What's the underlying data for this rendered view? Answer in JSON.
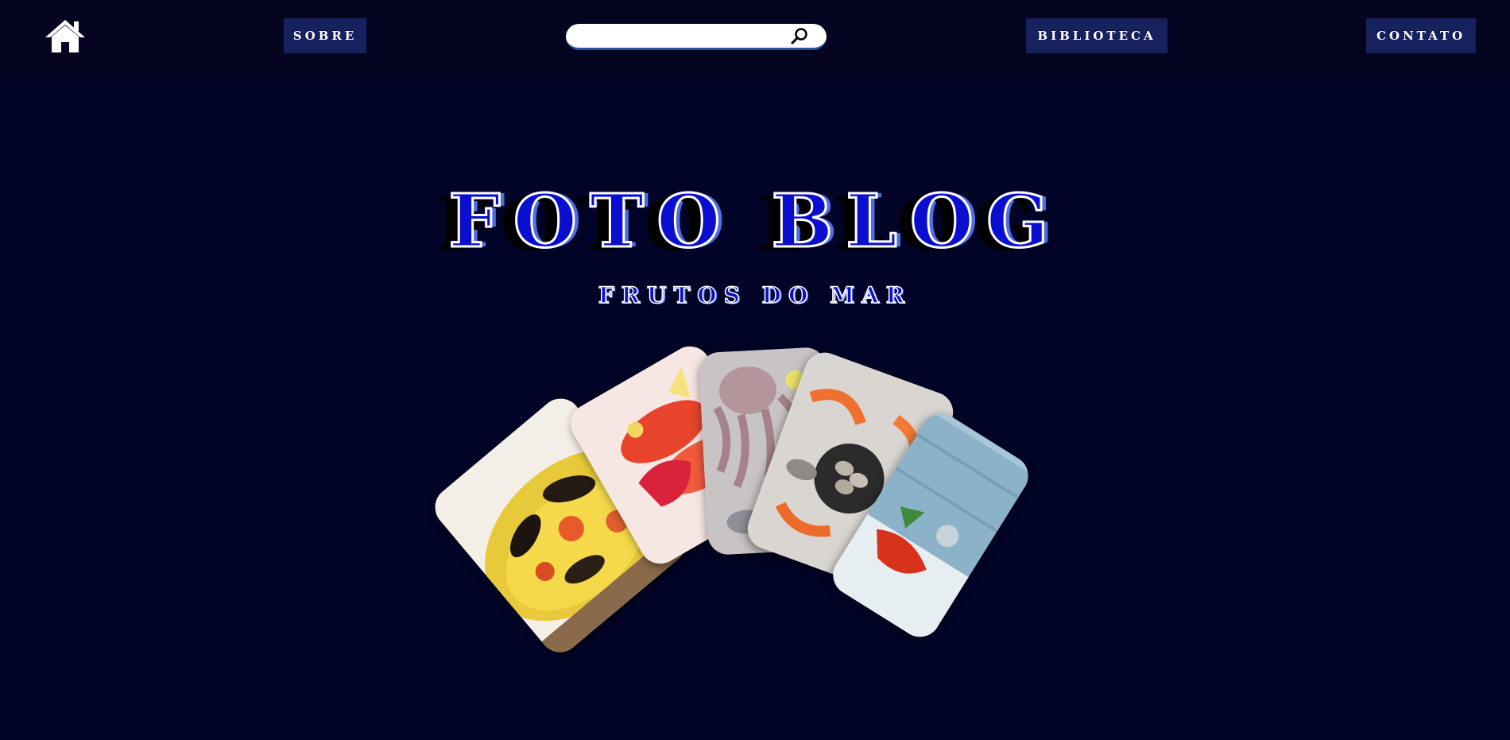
{
  "nav": {
    "home_icon": "home-icon",
    "sobre_label": "SOBRE",
    "biblioteca_label": "BIBLIOTECA",
    "contato_label": "CONTATO"
  },
  "search": {
    "value": "",
    "placeholder": "",
    "icon": "magnifier-icon"
  },
  "hero": {
    "title": "FOTO BLOG",
    "subtitle": "FRUTOS DO MAR"
  },
  "gallery": {
    "photos": [
      "paella-photo",
      "shrimp-strawberry-photo",
      "octopus-photo",
      "seafood-platter-photo",
      "lobster-ice-photo"
    ]
  },
  "colors": {
    "background": "#010426",
    "topbar": "#050521",
    "nav_button": "#16225e",
    "title_blue": "#0a0ed0",
    "title_light_blue": "#4d6fe0",
    "search_border": "#25509a"
  }
}
